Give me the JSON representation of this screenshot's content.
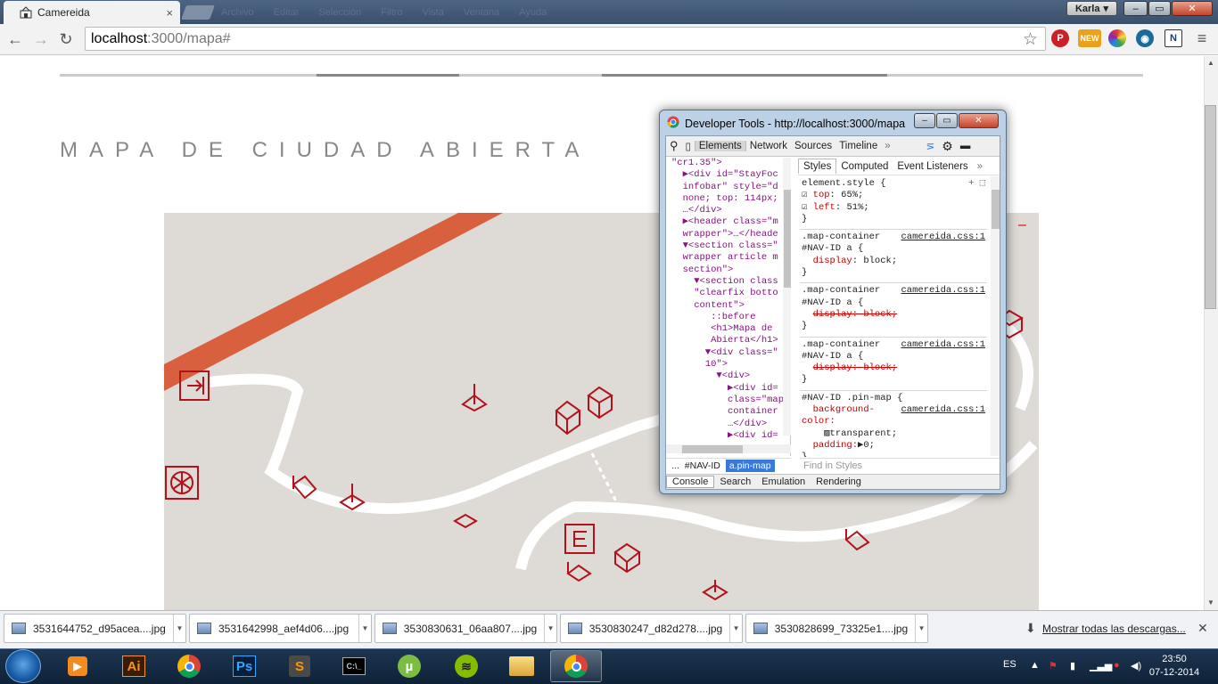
{
  "tab": {
    "title": "Camereida",
    "close": "×"
  },
  "ghost_menu": [
    "Archivo",
    "Editar",
    "Selección",
    "Filtro",
    "Vista",
    "Ventana",
    "Ayuda"
  ],
  "user": {
    "name": "Karla"
  },
  "window_controls": {
    "minimize": "–",
    "maximize": "▭",
    "close": "✕"
  },
  "nav": {
    "back": "←",
    "forward": "→",
    "reload": "↻"
  },
  "omnibox": {
    "host": "localhost",
    "path": ":3000/mapa#"
  },
  "extensions": {
    "new_badge": "NEW",
    "n_label": "N",
    "menu": "≡"
  },
  "page": {
    "title": "MAPA DE CIUDAD ABIERTA",
    "map_minus": "–"
  },
  "devtools": {
    "title": "Developer Tools - http://localhost:3000/mapa",
    "tabs": [
      "Elements",
      "Network",
      "Sources",
      "Timeline",
      "»"
    ],
    "elements_lines": [
      "\"cr1.35\">",
      "  ▶<div id=\"StayFoc",
      "  infobar\" style=\"d",
      "  none; top: 114px;",
      "  …</div>",
      "  ▶<header class=\"m",
      "  wrapper\">…</heade",
      "  ▼<section class=\"",
      "  wrapper article m",
      "  section\">",
      "    ▼<section class",
      "    \"clearfix botto",
      "    content\">",
      "       ::before",
      "       <h1>Mapa de",
      "       Abierta</h1>",
      "      ▼<div class=\"",
      "      10\">",
      "        ▼<div>",
      "          ▶<div id=",
      "          class=\"map",
      "          container",
      "          …</div>",
      "          ▶<div id="
    ],
    "breadcrumbs": [
      "...",
      "#NAV-ID",
      "a.pin-map"
    ],
    "style_tabs": [
      "Styles",
      "Computed",
      "Event Listeners",
      "»"
    ],
    "element_style": {
      "selector": "element.style {",
      "props": [
        {
          "name": "top",
          "value": "65%;"
        },
        {
          "name": "left",
          "value": "51%;"
        }
      ],
      "close": "}"
    },
    "rules": [
      {
        "sel1": ".map-container",
        "sel2": "#NAV-ID a {",
        "src": "camereida.css:1",
        "prop": "display",
        "value": "block;",
        "strike": false
      },
      {
        "sel1": ".map-container",
        "sel2": "#NAV-ID a {",
        "src": "camereida.css:1",
        "prop": "display",
        "value": "block;",
        "strike": true
      },
      {
        "sel1": ".map-container",
        "sel2": "#NAV-ID a {",
        "src": "camereida.css:1",
        "prop": "display",
        "value": "block;",
        "strike": true
      }
    ],
    "last_rule": {
      "sel": "#NAV-ID .pin-map {",
      "src": "camereida.css:1",
      "p1": "background-color:",
      "v1": "transparent;",
      "p2": "padding:",
      "v2": "▶0;"
    },
    "find_placeholder": "Find in Styles",
    "drawer_tabs": [
      "Console",
      "Search",
      "Emulation",
      "Rendering"
    ]
  },
  "downloads": {
    "items": [
      "3531644752_d95acea....jpg",
      "3531642998_aef4d06....jpg",
      "3530830631_06aa807....jpg",
      "3530830247_d82d278....jpg",
      "3530828699_73325e1....jpg"
    ],
    "show_all": "Mostrar todas las descargas...",
    "close": "✕"
  },
  "taskbar": {
    "apps": [
      "media-player",
      "illustrator",
      "chrome",
      "photoshop",
      "sublime",
      "terminal",
      "utorrent",
      "spotify",
      "explorer",
      "chrome-active"
    ],
    "lang": "ES",
    "time": "23:50",
    "date": "07-12-2014"
  }
}
